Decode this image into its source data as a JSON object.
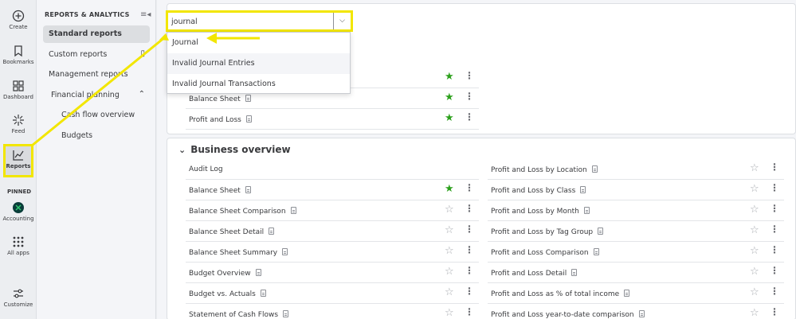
{
  "rail": {
    "items": [
      {
        "label": "Create",
        "icon": "plus-circle-icon"
      },
      {
        "label": "Bookmarks",
        "icon": "bookmark-icon"
      },
      {
        "label": "Dashboard",
        "icon": "grid-icon"
      },
      {
        "label": "Feed",
        "icon": "sparkle-icon"
      },
      {
        "label": "Reports",
        "icon": "chart-line-icon"
      },
      {
        "label": "Accounting",
        "icon": "accounting-icon"
      },
      {
        "label": "All apps",
        "icon": "apps-grid-icon"
      },
      {
        "label": "Customize",
        "icon": "sliders-icon"
      }
    ],
    "pinned_label": "PINNED"
  },
  "subnav": {
    "heading": "REPORTS & ANALYTICS",
    "items": [
      {
        "label": "Standard reports"
      },
      {
        "label": "Custom reports"
      },
      {
        "label": "Management reports"
      },
      {
        "label": "Financial planning"
      },
      {
        "label": "Cash flow overview"
      },
      {
        "label": "Budgets"
      }
    ]
  },
  "search": {
    "value": "journal",
    "options": [
      "Journal",
      "Invalid Journal Entries",
      "Invalid Journal Transactions"
    ]
  },
  "favorites": {
    "rows": [
      {
        "label": "Balance Sheet"
      },
      {
        "label": "Profit and Loss"
      }
    ]
  },
  "business_overview": {
    "title": "Business overview",
    "left": [
      {
        "label": "Audit Log"
      },
      {
        "label": "Balance Sheet"
      },
      {
        "label": "Balance Sheet Comparison"
      },
      {
        "label": "Balance Sheet Detail"
      },
      {
        "label": "Balance Sheet Summary"
      },
      {
        "label": "Budget Overview"
      },
      {
        "label": "Budget vs. Actuals"
      },
      {
        "label": "Statement of Cash Flows"
      }
    ],
    "right": [
      {
        "label": "Profit and Loss by Location"
      },
      {
        "label": "Profit and Loss by Class"
      },
      {
        "label": "Profit and Loss by Month"
      },
      {
        "label": "Profit and Loss by Tag Group"
      },
      {
        "label": "Profit and Loss Comparison"
      },
      {
        "label": "Profit and Loss Detail"
      },
      {
        "label": "Profit and Loss as % of total income"
      },
      {
        "label": "Profit and Loss year-to-date comparison"
      }
    ]
  },
  "colors": {
    "accent_green": "#2ca01c",
    "highlight_yellow": "#f2e600"
  }
}
